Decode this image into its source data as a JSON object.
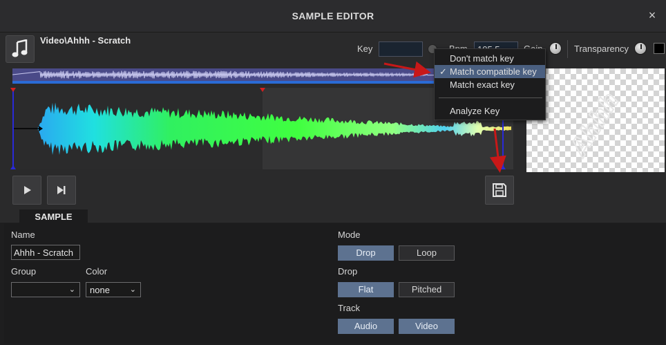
{
  "window": {
    "title": "SAMPLE EDITOR",
    "close_glyph": "×"
  },
  "sample": {
    "path": "Video\\Ahhh - Scratch"
  },
  "controls": {
    "key_label": "Key",
    "key_value": "",
    "bpm_label": "Bpm",
    "bpm_value": "105.5",
    "gain_label": "Gain",
    "transparency_label": "Transparency"
  },
  "key_menu": {
    "items": [
      {
        "label": "Don't match key",
        "checked": false
      },
      {
        "label": "Match compatible key",
        "checked": true
      },
      {
        "label": "Match exact key",
        "checked": false
      },
      {
        "label": "Analyze Key",
        "checked": false
      }
    ],
    "check_glyph": "✓"
  },
  "transport": {
    "play_icon": "play-icon",
    "next_icon": "skip-next-icon",
    "save_icon": "save-icon"
  },
  "tab": {
    "label": "SAMPLE"
  },
  "form": {
    "name_label": "Name",
    "name_value": "Ahhh - Scratch",
    "group_label": "Group",
    "group_value": "",
    "color_label": "Color",
    "color_value": "none",
    "mode_label": "Mode",
    "mode_options": [
      "Drop",
      "Loop"
    ],
    "mode_selected": "Drop",
    "drop_label": "Drop",
    "drop_options": [
      "Flat",
      "Pitched"
    ],
    "drop_selected": "Flat",
    "track_label": "Track",
    "track_options": [
      "Audio",
      "Video"
    ],
    "track_selected": [
      "Audio",
      "Video"
    ]
  },
  "colors": {
    "accent": "#5d7290",
    "overview": "#4a4a88",
    "cursor": "#2a2ad8",
    "marker": "#d42020"
  }
}
